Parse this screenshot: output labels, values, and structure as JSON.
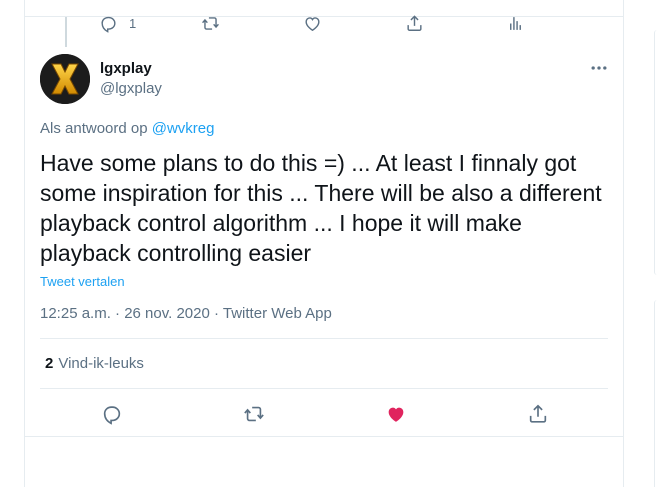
{
  "top_actions": {
    "reply_count": "1",
    "icons": [
      "reply-icon",
      "retweet-icon",
      "like-icon",
      "share-icon",
      "analytics-icon"
    ]
  },
  "tweet": {
    "display_name": "lgxplay",
    "handle": "@lgxplay",
    "reply_prefix": "Als antwoord op",
    "reply_mention": "@wvkreg",
    "text": "Have some plans to do this =) ... At least I finnaly got some inspiration for this ... There will be also a different playback control algorithm ... I hope it will make playback controlling easier",
    "translate_label": "Tweet vertalen",
    "meta": "12:25 a.m. · 26 nov. 2020 · Twitter Web App",
    "likes_count": "2",
    "likes_label": "Vind-ik-leuks"
  },
  "colors": {
    "accent": "#1da1f2",
    "secondary_text": "#5b7083",
    "like_active": "#e0245e",
    "border": "#e6ecf0"
  }
}
